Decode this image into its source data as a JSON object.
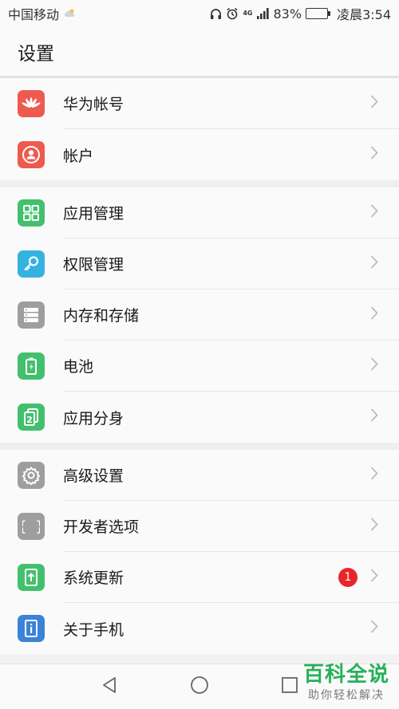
{
  "status_bar": {
    "carrier": "中国移动",
    "network": "4G",
    "battery": "83%",
    "battery_level": 0.83,
    "time": "凌晨3:54",
    "icons": [
      "weather-icon",
      "headphone-icon",
      "alarm-icon",
      "signal-icon",
      "battery-icon"
    ]
  },
  "header": {
    "title": "设置"
  },
  "groups": [
    {
      "items": [
        {
          "label": "华为帐号",
          "icon": "huawei-logo-icon",
          "color": "#ee5a4e"
        },
        {
          "label": "帐户",
          "icon": "user-icon",
          "color": "#ee5a4e"
        }
      ]
    },
    {
      "items": [
        {
          "label": "应用管理",
          "icon": "grid-icon",
          "color": "#43c06d"
        },
        {
          "label": "权限管理",
          "icon": "key-icon",
          "color": "#35b3e0"
        },
        {
          "label": "内存和存储",
          "icon": "storage-icon",
          "color": "#9e9e9e"
        },
        {
          "label": "电池",
          "icon": "battery-icon",
          "color": "#43c06d"
        },
        {
          "label": "应用分身",
          "icon": "app-twin-icon",
          "color": "#43c06d"
        }
      ]
    },
    {
      "items": [
        {
          "label": "高级设置",
          "icon": "gear-icon",
          "color": "#9e9e9e"
        },
        {
          "label": "开发者选项",
          "icon": "braces-icon",
          "color": "#9e9e9e"
        },
        {
          "label": "系统更新",
          "icon": "system-update-icon",
          "color": "#43c06d",
          "badge": "1"
        },
        {
          "label": "关于手机",
          "icon": "info-icon",
          "color": "#3a83d6"
        }
      ]
    }
  ],
  "nav_bar": {
    "icons": [
      "back-icon",
      "home-icon",
      "recent-apps-icon"
    ]
  },
  "watermark": {
    "title": "百科全说",
    "subtitle": "助你轻松解决"
  },
  "colors": {
    "badge": "#e8262a",
    "chevron": "#bdbdbd",
    "background": "#f2f2f2"
  }
}
